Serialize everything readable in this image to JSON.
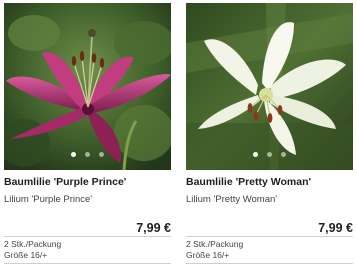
{
  "products": [
    {
      "title": "Baumlilie 'Purple Prince'",
      "latin_name": "Lilium 'Purple Prince'",
      "price": "7,99 €",
      "pack": "2 Stk./Packung",
      "size": "Größe 16/+",
      "image": "purple-lily-photo",
      "carousel_dots": 3,
      "carousel_active": 1
    },
    {
      "title": "Baumlilie 'Pretty Woman'",
      "latin_name": "Lilium 'Pretty Woman'",
      "price": "7,99 €",
      "pack": "2 Stk./Packung",
      "size": "Größe 16/+",
      "image": "white-lily-photo",
      "carousel_dots": 3,
      "carousel_active": 1
    }
  ],
  "colors": {
    "purple_petal": "#b0306a",
    "white_petal": "#f4f6ec",
    "foliage": "#3f6e2a"
  }
}
